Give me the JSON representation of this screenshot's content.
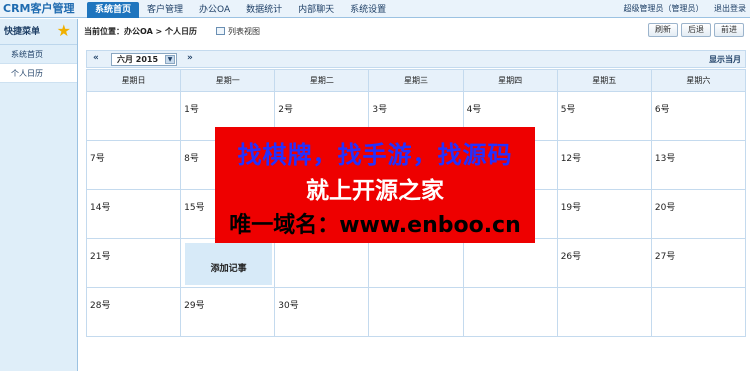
{
  "app": {
    "logo": "CRM客户管理"
  },
  "nav": [
    "系统首页",
    "客户管理",
    "办公OA",
    "数据统计",
    "内部聊天",
    "系统设置"
  ],
  "user": {
    "name": "超级管理员（管理员）",
    "logout": "退出登录"
  },
  "sidebar": {
    "title": "快捷菜单",
    "items": [
      "系统首页",
      "个人日历"
    ]
  },
  "breadcrumb": "当前位置：办公OA > 个人日历",
  "list_view": "列表视图",
  "buttons": {
    "refresh": "刷新",
    "back": "后退",
    "forward": "前进"
  },
  "calendar": {
    "prev": "«",
    "next": "»",
    "month": "六月 2015",
    "show_month": "显示当月",
    "weekdays": [
      "星期日",
      "星期一",
      "星期二",
      "星期三",
      "星期四",
      "星期五",
      "星期六"
    ],
    "weeks": [
      [
        "",
        "1号",
        "2号",
        "3号",
        "4号",
        "5号",
        "6号"
      ],
      [
        "7号",
        "8号",
        "",
        "",
        "",
        "12号",
        "13号"
      ],
      [
        "14号",
        "15号",
        "",
        "",
        "",
        "19号",
        "20号"
      ],
      [
        "21号",
        "",
        "",
        "",
        "",
        "26号",
        "27号"
      ],
      [
        "28号",
        "29号",
        "30号",
        "",
        "",
        "",
        ""
      ]
    ],
    "add_note": "添加记事"
  },
  "banner": {
    "line1": "找棋牌，找手游，找源码",
    "line2": "就上开源之家",
    "line3": "唯一域名：www.enboo.cn",
    "colors": {
      "background": "#ee0000",
      "line1": "#2430ff",
      "line2": "#ffffff",
      "line3": "#000000"
    }
  }
}
